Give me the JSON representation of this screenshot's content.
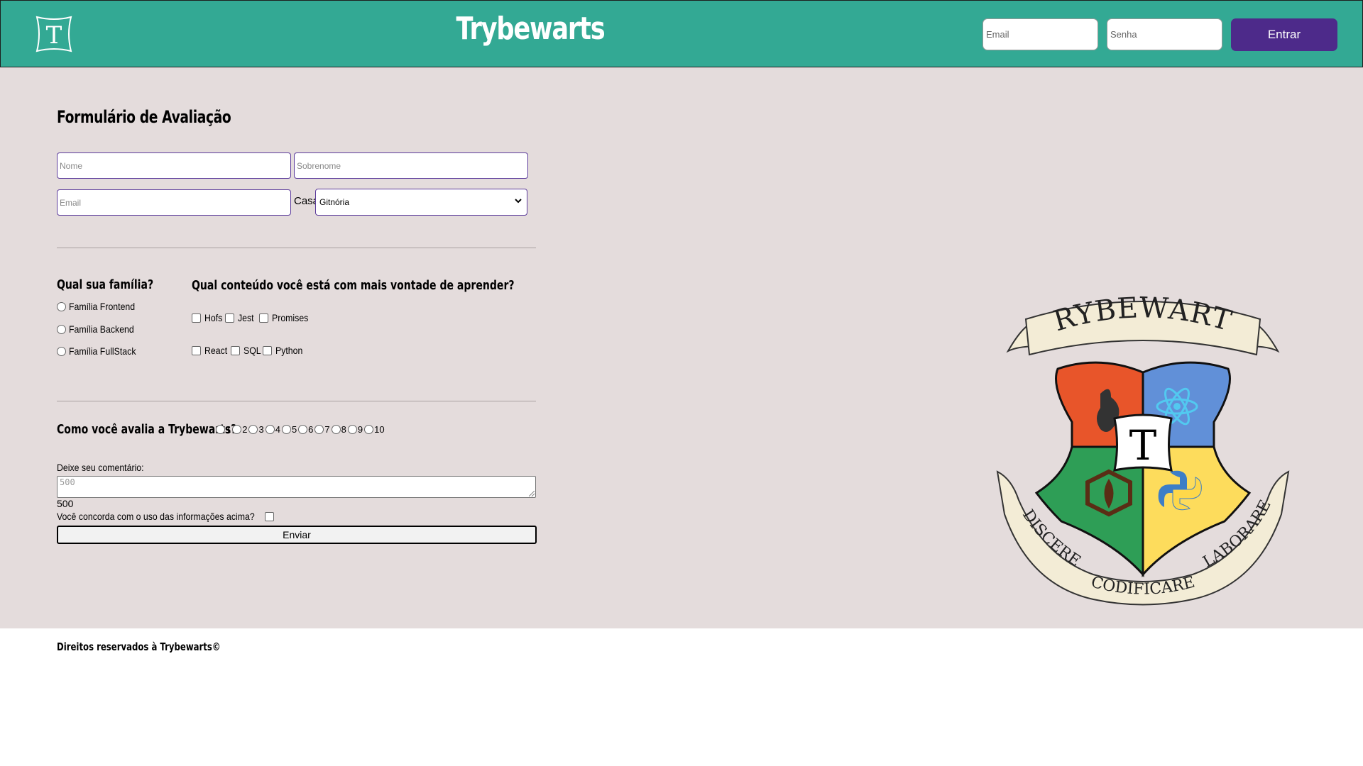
{
  "header": {
    "logo_letter": "T",
    "brand": "Trybewarts",
    "login": {
      "email_placeholder": "Email",
      "password_placeholder": "Senha",
      "button_label": "Entrar"
    }
  },
  "form": {
    "title": "Formulário de Avaliação",
    "name_placeholder": "Nome",
    "lastname_placeholder": "Sobrenome",
    "email_placeholder": "Email",
    "house_label": "Casa:",
    "house_selected": "Gitnória",
    "family": {
      "question": "Qual sua família?",
      "options": [
        "Família Frontend",
        "Família Backend",
        "Família FullStack"
      ]
    },
    "content": {
      "question": "Qual conteúdo você está com mais vontade de aprender?",
      "row1": [
        "Hofs",
        "Jest",
        "Promises"
      ],
      "row2": [
        "React",
        "SQL",
        "Python"
      ]
    },
    "rating": {
      "question": "Como você avalia a Trybewarts?",
      "options": [
        "1",
        "2",
        "3",
        "4",
        "5",
        "6",
        "7",
        "8",
        "9",
        "10"
      ]
    },
    "comment_label": "Deixe seu comentário:",
    "comment_placeholder": "500",
    "counter": "500",
    "agree_label": "Você concorda com o uso das informações acima?",
    "submit_label": "Enviar"
  },
  "crest": {
    "banner_top": "TRYBEWARTS",
    "center_letter": "T",
    "motto_left": "DISCERE",
    "motto_bottom": "CODIFICARE",
    "motto_right": "LABORARE"
  },
  "footer": {
    "text": "Direitos reservados à Trybewarts©"
  },
  "colors": {
    "header_bg": "#33a994",
    "main_bg": "#e4dcdc",
    "login_button": "#4d2a8a",
    "crest_red": "#e8552a",
    "crest_blue": "#6190d8",
    "crest_green": "#2e9e56",
    "crest_yellow": "#fddc5c"
  }
}
